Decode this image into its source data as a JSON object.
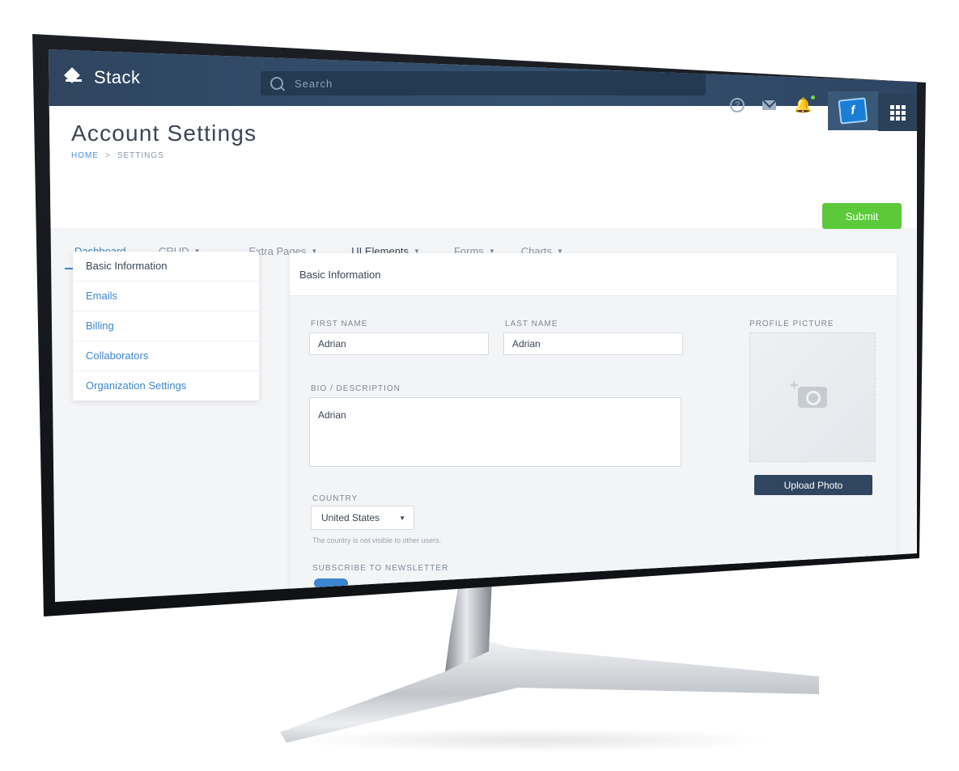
{
  "app": {
    "brand": "Stack"
  },
  "search": {
    "placeholder": "Search"
  },
  "header": {
    "title": "Account Settings",
    "breadcrumb": {
      "home": "HOME",
      "separator": ">",
      "current": "SETTINGS"
    },
    "submit_label": "Submit"
  },
  "nav": {
    "tabs": [
      {
        "label": "Dashboard",
        "active": true
      },
      {
        "label": "CRUD"
      },
      {
        "label": "Extra Pages"
      },
      {
        "label": "UI Elements"
      },
      {
        "label": "Forms"
      },
      {
        "label": "Charts"
      }
    ],
    "caret": "▼"
  },
  "sidebar": {
    "items": [
      {
        "label": "Basic Information"
      },
      {
        "label": "Emails"
      },
      {
        "label": "Billing"
      },
      {
        "label": "Collaborators"
      },
      {
        "label": "Organization Settings"
      }
    ]
  },
  "form": {
    "section_title": "Basic Information",
    "first_name": {
      "label": "FIRST NAME",
      "value": "Adrian"
    },
    "last_name": {
      "label": "LAST NAME",
      "value": "Adrian"
    },
    "bio": {
      "label": "BIO / DESCRIPTION",
      "value": "Adrian"
    },
    "country": {
      "label": "COUNTRY",
      "value": "United States",
      "hint": "The country is not visible to other users."
    },
    "newsletter": {
      "label": "SUBSCRIBE TO NEWSLETTER"
    },
    "profile_picture": {
      "label": "PROFILE PICTURE",
      "upload_label": "Upload Photo"
    }
  },
  "icons": {
    "help": "?",
    "bell": "🔔",
    "avatar_letter": "f"
  },
  "colors": {
    "topbar": "#2f4560",
    "accent": "#3b86cf",
    "submit": "#5cc93a"
  }
}
